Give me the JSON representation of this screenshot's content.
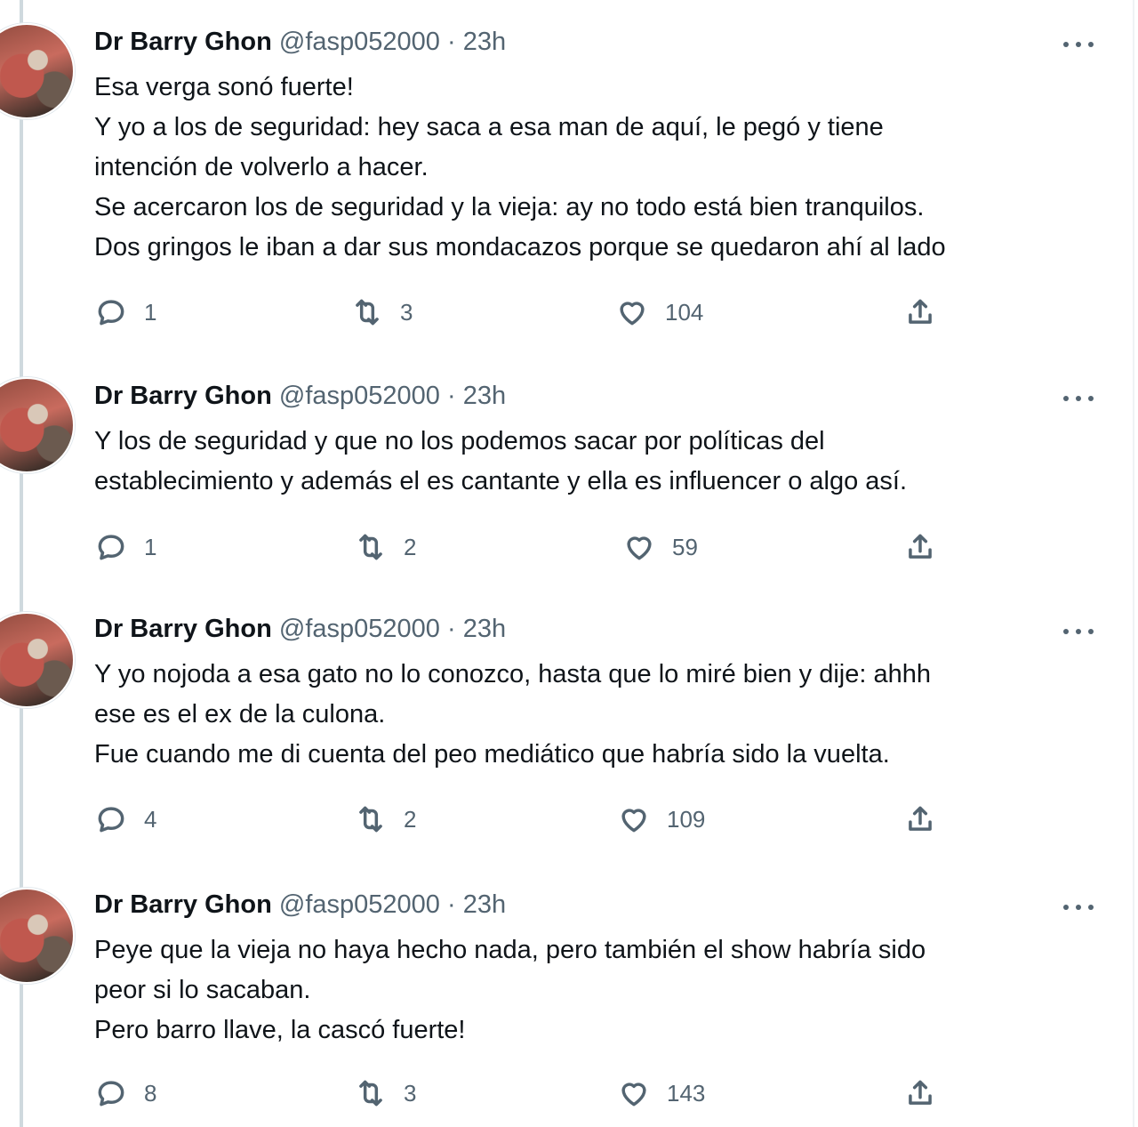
{
  "tweets": [
    {
      "name": "Dr Barry Ghon",
      "handle": "@fasp052000",
      "separator": "·",
      "time": "23h",
      "lines": [
        "Esa verga sonó fuerte!",
        "Y yo a los de seguridad: hey saca a esa man de aquí, le pegó y tiene",
        "intención de volverlo a hacer.",
        "Se acercaron los de seguridad y la vieja: ay no todo está bien tranquilos.",
        "Dos gringos le iban a dar sus mondacazos porque se quedaron ahí al lado"
      ],
      "replies": "1",
      "retweets": "3",
      "likes": "104"
    },
    {
      "name": "Dr Barry Ghon",
      "handle": "@fasp052000",
      "separator": "·",
      "time": "23h",
      "lines": [
        "Y los de seguridad y que no los podemos sacar por políticas del",
        "establecimiento y además el es cantante y ella es influencer o algo así."
      ],
      "replies": "1",
      "retweets": "2",
      "likes": "59"
    },
    {
      "name": "Dr Barry Ghon",
      "handle": "@fasp052000",
      "separator": "·",
      "time": "23h",
      "lines": [
        "Y yo nojoda a esa gato no lo conozco, hasta que lo miré bien y dije: ahhh",
        "ese es el ex de la culona.",
        "Fue cuando me di cuenta del peo mediático que habría sido la vuelta."
      ],
      "replies": "4",
      "retweets": "2",
      "likes": "109"
    },
    {
      "name": "Dr Barry Ghon",
      "handle": "@fasp052000",
      "separator": "·",
      "time": "23h",
      "lines": [
        "Peye que la vieja no haya hecho nada, pero también el show habría sido",
        "peor si lo sacaban.",
        "Pero barro llave, la cascó fuerte!"
      ],
      "replies": "8",
      "retweets": "3",
      "likes": "143"
    }
  ],
  "icons": {
    "reply": "reply-icon",
    "retweet": "retweet-icon",
    "like": "heart-icon",
    "share": "share-icon",
    "more": "more-icon"
  },
  "colors": {
    "text": "#0f1419",
    "secondary": "#536471",
    "thread_line": "#cfd9de"
  }
}
